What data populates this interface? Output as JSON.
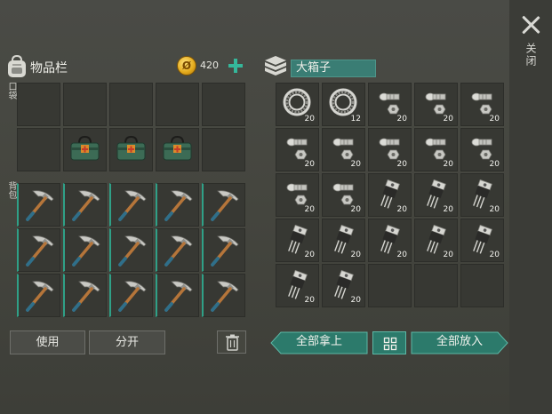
{
  "inventory": {
    "title": "物品栏",
    "coins": "420",
    "coin_symbol": "Ø",
    "pocket_label": "口袋",
    "backpack_label": "背包",
    "icon": "backpack-icon",
    "pocket_items": [
      {
        "icon": "empty"
      },
      {
        "icon": "empty"
      },
      {
        "icon": "empty"
      },
      {
        "icon": "empty"
      },
      {
        "icon": "empty"
      },
      {
        "icon": "empty"
      },
      {
        "icon": "medkit-bag-icon"
      },
      {
        "icon": "medkit-bag-icon"
      },
      {
        "icon": "medkit-bag-icon"
      },
      {
        "icon": "empty"
      }
    ],
    "backpack_items": [
      {
        "icon": "pickaxe-icon"
      },
      {
        "icon": "pickaxe-icon"
      },
      {
        "icon": "pickaxe-icon"
      },
      {
        "icon": "pickaxe-icon"
      },
      {
        "icon": "pickaxe-icon"
      },
      {
        "icon": "pickaxe-icon"
      },
      {
        "icon": "pickaxe-icon"
      },
      {
        "icon": "pickaxe-icon"
      },
      {
        "icon": "pickaxe-icon"
      },
      {
        "icon": "pickaxe-icon"
      },
      {
        "icon": "pickaxe-icon"
      },
      {
        "icon": "pickaxe-icon"
      },
      {
        "icon": "pickaxe-icon"
      },
      {
        "icon": "pickaxe-icon"
      },
      {
        "icon": "pickaxe-icon"
      }
    ],
    "use_label": "使用",
    "split_label": "分开"
  },
  "chest": {
    "title": "大箱子",
    "icon": "chest-icon",
    "items": [
      {
        "icon": "bearing-icon",
        "qty": "20"
      },
      {
        "icon": "bearing-icon",
        "qty": "12"
      },
      {
        "icon": "bolt-nut-icon",
        "qty": "20"
      },
      {
        "icon": "bolt-nut-icon",
        "qty": "20"
      },
      {
        "icon": "bolt-nut-icon",
        "qty": "20"
      },
      {
        "icon": "bolt-nut-icon",
        "qty": "20"
      },
      {
        "icon": "bolt-nut-icon",
        "qty": "20"
      },
      {
        "icon": "bolt-nut-icon",
        "qty": "20"
      },
      {
        "icon": "bolt-nut-icon",
        "qty": "20"
      },
      {
        "icon": "bolt-nut-icon",
        "qty": "20"
      },
      {
        "icon": "bolt-nut-icon",
        "qty": "20"
      },
      {
        "icon": "bolt-nut-icon",
        "qty": "20"
      },
      {
        "icon": "transistor-icon",
        "qty": "20"
      },
      {
        "icon": "transistor-icon",
        "qty": "20"
      },
      {
        "icon": "transistor-icon",
        "qty": "20"
      },
      {
        "icon": "transistor-icon",
        "qty": "20"
      },
      {
        "icon": "transistor-icon",
        "qty": "20"
      },
      {
        "icon": "transistor-icon",
        "qty": "20"
      },
      {
        "icon": "transistor-icon",
        "qty": "20"
      },
      {
        "icon": "transistor-icon",
        "qty": "20"
      },
      {
        "icon": "transistor-icon",
        "qty": "20"
      },
      {
        "icon": "transistor-icon",
        "qty": "20"
      },
      {
        "icon": "empty",
        "qty": ""
      },
      {
        "icon": "empty",
        "qty": ""
      },
      {
        "icon": "empty",
        "qty": ""
      }
    ],
    "take_all_label": "全部拿上",
    "put_all_label": "全部放入"
  },
  "close_label": "关闭",
  "colors": {
    "accent": "#2fa087",
    "button_teal": "#2c7a6b",
    "coin": "#e2a81a"
  }
}
